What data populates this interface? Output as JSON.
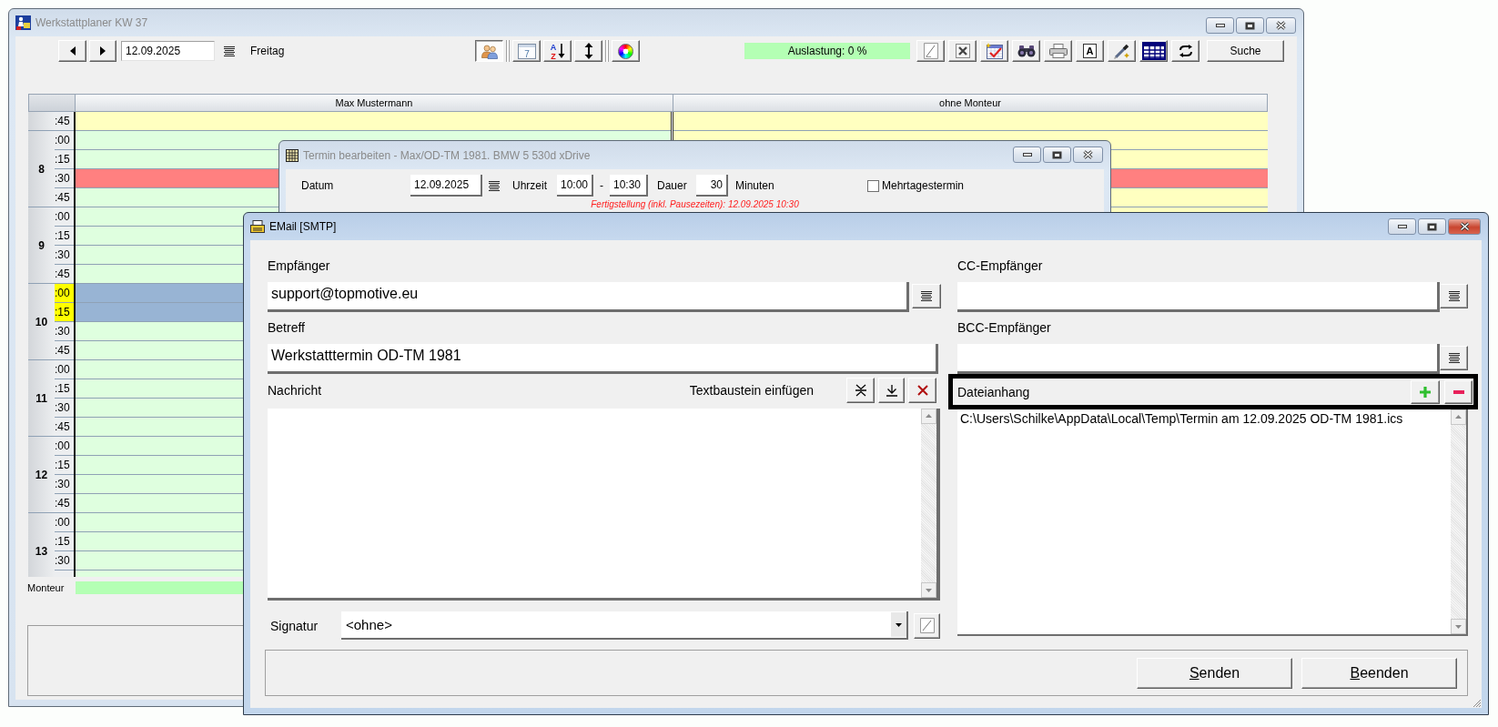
{
  "main_window": {
    "title": "Werkstattplaner KW 37",
    "active": false
  },
  "toolbar": {
    "date": "12.09.2025",
    "weekday": "Freitag",
    "view_buttons": [
      {
        "kind": "users",
        "pressed": true
      },
      {
        "kind": "separator"
      },
      {
        "kind": "calendar",
        "text": "7",
        "pressed": false
      },
      {
        "kind": "sort",
        "text": "A",
        "text_2": "Z",
        "pressed": false
      },
      {
        "kind": "height",
        "pressed": false
      },
      {
        "kind": "separator"
      },
      {
        "kind": "colors",
        "pressed": false
      }
    ],
    "utilization": "Auslastung: 0 %",
    "action_buttons": [
      {
        "kind": "note"
      },
      {
        "kind": "delete"
      },
      {
        "kind": "calendar_check"
      },
      {
        "kind": "binoculars"
      },
      {
        "kind": "print"
      },
      {
        "kind": "letter",
        "text": "A"
      },
      {
        "kind": "pen"
      },
      {
        "kind": "table"
      },
      {
        "kind": "swap"
      }
    ],
    "search_button": "Suche"
  },
  "planner": {
    "columns": [
      {
        "name": "Max Mustermann"
      },
      {
        "name": "ohne Monteur"
      }
    ],
    "hours": [
      {
        "slots": [
          {
            "minute": ":45",
            "highlighted": false,
            "cells": [
              {
                "color": "#ffffc0"
              },
              {
                "color": "#ffffc0"
              }
            ]
          }
        ]
      },
      {
        "hour": "8",
        "slots": [
          {
            "minute": ":00",
            "highlighted": false,
            "cells": [
              {
                "color": "#dfffdf"
              },
              {
                "color": "#ffffc0"
              }
            ]
          },
          {
            "minute": ":15",
            "highlighted": false,
            "cells": [
              {
                "color": "#dfffdf"
              },
              {
                "color": "#ffffc0"
              }
            ]
          },
          {
            "minute": ":30",
            "highlighted": false,
            "cells": [
              {
                "color": "#ff8080"
              },
              {
                "color": "#ff8080"
              }
            ]
          },
          {
            "minute": ":45",
            "highlighted": false,
            "cells": [
              {
                "color": "#dfffdf"
              },
              {
                "color": "#ffffc0"
              }
            ]
          }
        ]
      },
      {
        "hour": "9",
        "slots": [
          {
            "minute": ":00",
            "highlighted": false,
            "cells": [
              {
                "color": "#dfffdf"
              },
              {
                "color": "#ffffc0"
              }
            ]
          },
          {
            "minute": ":15",
            "highlighted": false,
            "cells": [
              {
                "color": "#dfffdf"
              }
            ]
          },
          {
            "minute": ":30",
            "highlighted": false,
            "cells": [
              {
                "color": "#dfffdf"
              }
            ]
          },
          {
            "minute": ":45",
            "highlighted": false,
            "cells": [
              {
                "color": "#dfffdf"
              }
            ]
          }
        ]
      },
      {
        "hour": "10",
        "slots": [
          {
            "minute": ":00",
            "highlighted": true,
            "cells": [
              {
                "color": "#98b4d4"
              }
            ]
          },
          {
            "minute": ":15",
            "highlighted": true,
            "cells": [
              {
                "color": "#98b4d4"
              }
            ]
          },
          {
            "minute": ":30",
            "highlighted": false,
            "cells": [
              {
                "color": "#dfffdf"
              }
            ]
          },
          {
            "minute": ":45",
            "highlighted": false,
            "cells": [
              {
                "color": "#dfffdf"
              }
            ]
          }
        ]
      },
      {
        "hour": "11",
        "slots": [
          {
            "minute": ":00",
            "highlighted": false,
            "cells": [
              {
                "color": "#dfffdf"
              }
            ]
          },
          {
            "minute": ":15",
            "highlighted": false,
            "cells": [
              {
                "color": "#dfffdf"
              }
            ]
          },
          {
            "minute": ":30",
            "highlighted": false,
            "cells": [
              {
                "color": "#dfffdf"
              }
            ]
          },
          {
            "minute": ":45",
            "highlighted": false,
            "cells": [
              {
                "color": "#dfffdf"
              }
            ]
          }
        ]
      },
      {
        "hour": "12",
        "slots": [
          {
            "minute": ":00",
            "highlighted": false,
            "cells": [
              {
                "color": "#dfffdf"
              }
            ]
          },
          {
            "minute": ":15",
            "highlighted": false,
            "cells": [
              {
                "color": "#dfffdf"
              }
            ]
          },
          {
            "minute": ":30",
            "highlighted": false,
            "cells": [
              {
                "color": "#dfffdf"
              }
            ]
          },
          {
            "minute": ":45",
            "highlighted": false,
            "cells": [
              {
                "color": "#dfffdf"
              }
            ]
          }
        ]
      },
      {
        "hour": "13",
        "slots": [
          {
            "minute": ":00",
            "highlighted": false,
            "cells": [
              {
                "color": "#dfffdf"
              }
            ]
          },
          {
            "minute": ":15",
            "highlighted": false,
            "cells": [
              {
                "color": "#dfffdf"
              }
            ]
          },
          {
            "minute": ":30",
            "highlighted": false,
            "cells": [
              {
                "color": "#dfffdf"
              }
            ]
          },
          {
            "highlighted": false,
            "cells": [
              {
                "color": "#dfffdf"
              }
            ]
          }
        ]
      }
    ],
    "monteur_label": "Monteur"
  },
  "appointment_dialog": {
    "title": "Termin bearbeiten - Max/OD-TM 1981. BMW 5 530d xDrive",
    "active": false,
    "date_label": "Datum",
    "date": "12.09.2025",
    "time_label": "Uhrzeit",
    "start_time": "10:00",
    "time_separator": "-",
    "end_time": "10:30",
    "duration_label": "Dauer",
    "duration": "30",
    "duration_unit": "Minuten",
    "multi_day": {
      "label": "Mehrtagestermin",
      "checked": false
    },
    "completion_note": "Fertigstellung (inkl. Pausezeiten): 12.09.2025 10:30"
  },
  "email_dialog": {
    "title": "EMail [SMTP]",
    "active": true,
    "recipient": {
      "label": "Empfänger",
      "value": "support@topmotive.eu"
    },
    "cc": {
      "label": "CC-Empfänger"
    },
    "subject": {
      "label": "Betreff",
      "value": "Werkstatttermin OD-TM 1981"
    },
    "bcc": {
      "label": "BCC-Empfänger"
    },
    "message": {
      "label": "Nachricht",
      "snippet_label": "Textbaustein einfügen"
    },
    "attachments": {
      "label": "Dateianhang",
      "highlighted": true,
      "files": [
        {
          "path": "C:\\Users\\Schilke\\AppData\\Local\\Temp\\Termin am 12.09.2025 OD-TM 1981.ics",
          "selected": false
        }
      ]
    },
    "signature": {
      "label": "Signatur",
      "value": "<ohne>"
    },
    "buttons": [
      {
        "label": "Senden"
      },
      {
        "label": "Beenden"
      }
    ]
  }
}
